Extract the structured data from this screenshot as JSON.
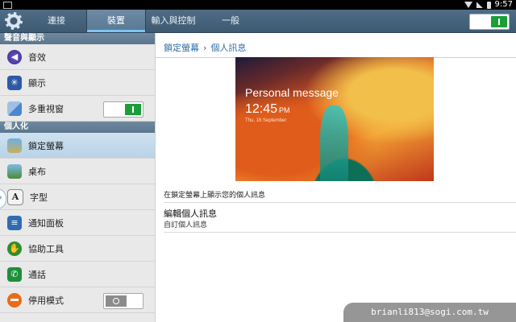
{
  "status_bar": {
    "time": "9:57"
  },
  "action_bar": {
    "tabs": [
      {
        "label": "連接",
        "active": false
      },
      {
        "label": "裝置",
        "active": true
      },
      {
        "label": "輸入與控制",
        "active": false
      },
      {
        "label": "一般",
        "active": false
      }
    ],
    "master_toggle_state": "on"
  },
  "sidebar": {
    "sections": [
      {
        "header": "聲音與顯示",
        "items": [
          {
            "label": "音效",
            "icon": "speaker-icon"
          },
          {
            "label": "顯示",
            "icon": "brightness-icon"
          },
          {
            "label": "多重視窗",
            "icon": "multi-window-icon",
            "toggle": "on"
          }
        ]
      },
      {
        "header": "個人化",
        "items": [
          {
            "label": "鎖定螢幕",
            "icon": "lock-screen-icon",
            "selected": true
          },
          {
            "label": "桌布",
            "icon": "wallpaper-icon"
          },
          {
            "label": "字型",
            "icon": "font-icon",
            "glyph": "A"
          },
          {
            "label": "通知面板",
            "icon": "notification-panel-icon"
          },
          {
            "label": "協助工具",
            "icon": "accessibility-icon"
          },
          {
            "label": "通話",
            "icon": "phone-icon"
          },
          {
            "label": "停用模式",
            "icon": "blocking-mode-icon",
            "toggle": "off"
          }
        ]
      }
    ]
  },
  "main": {
    "breadcrumb": {
      "parent": "鎖定螢幕",
      "current": "個人訊息"
    },
    "preview": {
      "message": "Personal message",
      "time": "12:45",
      "ampm": "PM",
      "date": "Thu, 16 September"
    },
    "description": "在鎖定螢幕上顯示您的個人訊息",
    "edit": {
      "title": "編輯個人訊息",
      "subtitle": "自訂個人訊息"
    }
  },
  "watermark": "brianli813@sogi.com.tw"
}
